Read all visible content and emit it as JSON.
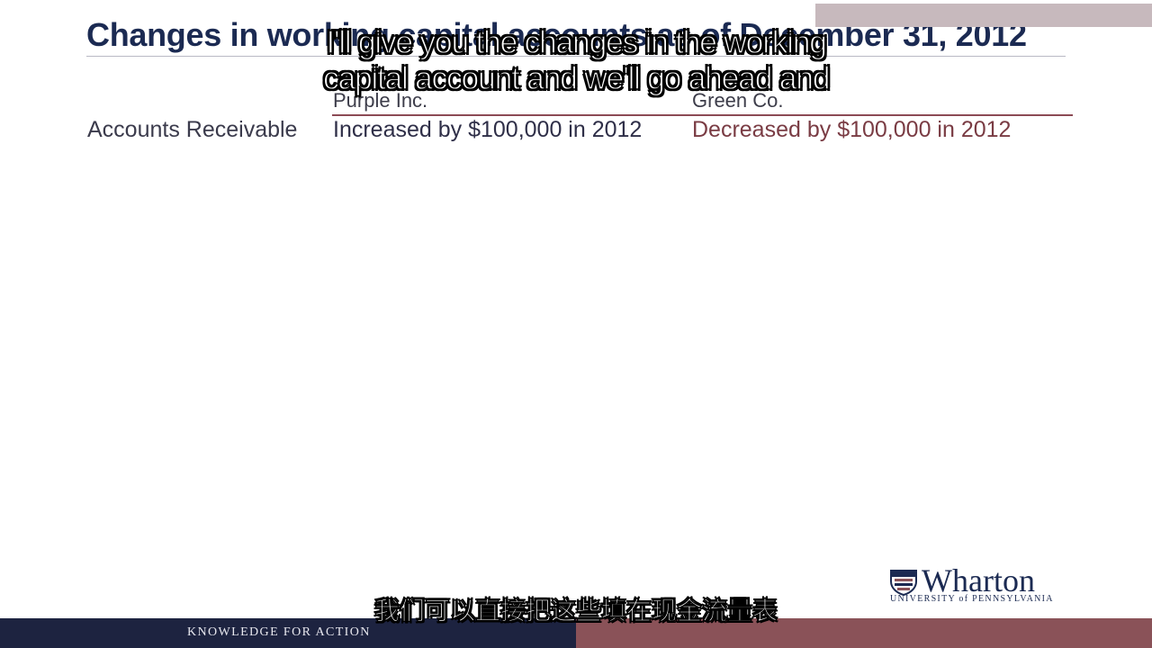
{
  "slide": {
    "title": "Changes in working capital accounts as of December 31, 2012",
    "columns": [
      "Purple Inc.",
      "Green Co."
    ],
    "rows": [
      {
        "label": "Accounts Receivable",
        "purple": "Increased by $100,000 in 2012",
        "green": "Decreased by $100,000 in 2012"
      }
    ]
  },
  "subtitles": {
    "english": [
      "I'll give you the changes in the working",
      "capital account and we'll go ahead and"
    ],
    "chinese": "我们可以直接把这些填在现金流量表"
  },
  "logo": {
    "name": "Wharton",
    "subtitle": "UNIVERSITY of PENNSYLVANIA"
  },
  "footer": {
    "tagline": "KNOWLEDGE FOR ACTION"
  },
  "colors": {
    "title": "#1b2a52",
    "navy": "#1d2340",
    "maroon": "#8a5258",
    "green_text": "#7a3c44"
  }
}
